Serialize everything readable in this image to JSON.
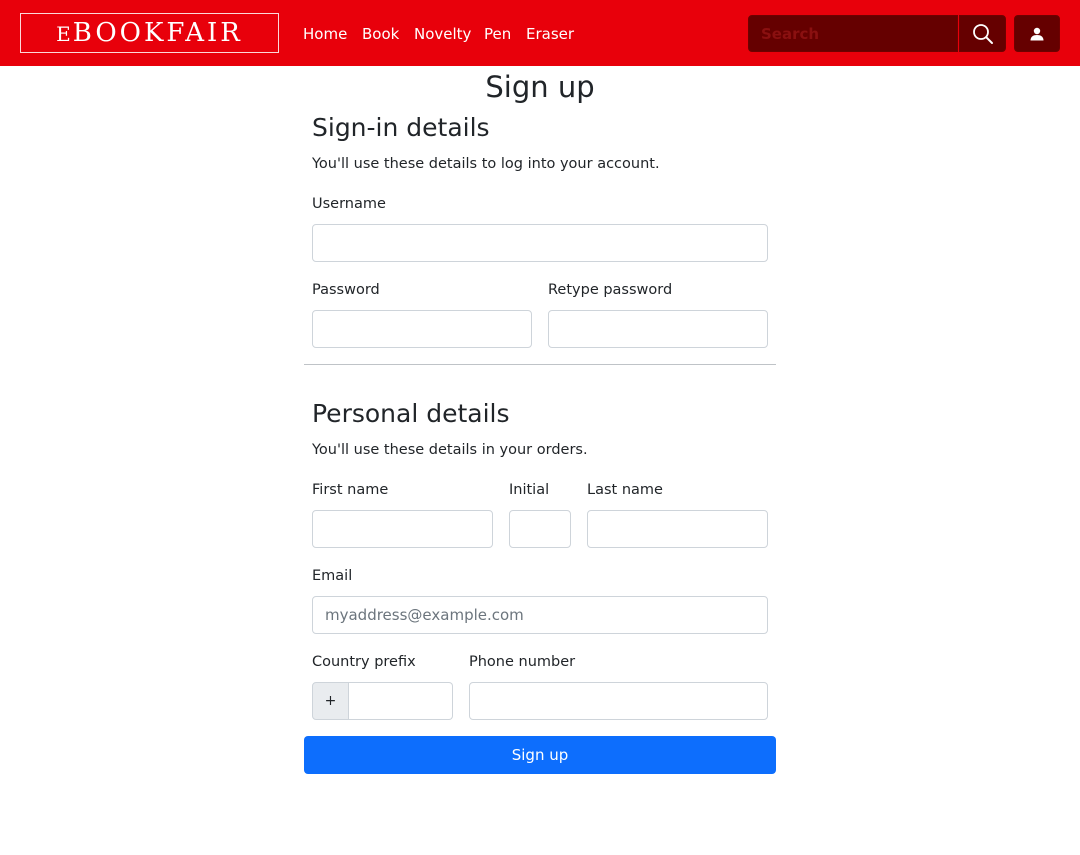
{
  "colors": {
    "brand": "#e8000b",
    "navbar_control": "#650000",
    "primary": "#0d6efd"
  },
  "navbar": {
    "logo_prefix": "E",
    "logo_text": "BOOKFAIR",
    "links": [
      "Home",
      "Book",
      "Novelty",
      "Pen",
      "Eraser"
    ],
    "search": {
      "placeholder": "Search",
      "icon": "search-icon"
    },
    "user_icon": "user-icon"
  },
  "page": {
    "title": "Sign up"
  },
  "signin": {
    "title": "Sign-in details",
    "description": "You'll use these details to log into your account.",
    "username_label": "Username",
    "username_value": "",
    "password_label": "Password",
    "password_value": "",
    "retype_label": "Retype password",
    "retype_value": ""
  },
  "personal": {
    "title": "Personal details",
    "description": "You'll use these details in your orders.",
    "first_name_label": "First name",
    "first_name_value": "",
    "initial_label": "Initial",
    "initial_value": "",
    "last_name_label": "Last name",
    "last_name_value": "",
    "email_label": "Email",
    "email_placeholder": "myaddress@example.com",
    "email_value": "",
    "country_prefix_label": "Country prefix",
    "country_prefix_symbol": "+",
    "country_prefix_value": "",
    "phone_label": "Phone number",
    "phone_value": ""
  },
  "submit_label": "Sign up"
}
